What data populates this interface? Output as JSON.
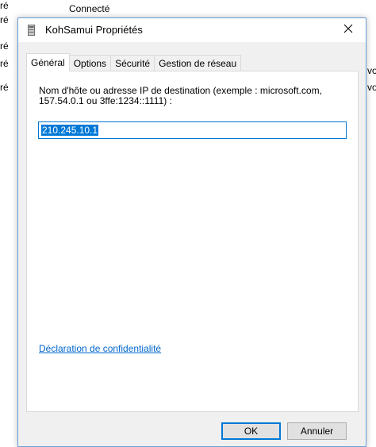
{
  "background": {
    "left_fragments": [
      "ré",
      "ré",
      "ré",
      "ré",
      "ré"
    ],
    "top_text": "Connecté",
    "right_fragments": [
      "vo",
      "vo"
    ]
  },
  "dialog": {
    "title": "KohSamui Propriétés",
    "close_glyph": "✕",
    "tabs": [
      {
        "label": "Général",
        "active": true
      },
      {
        "label": "Options",
        "active": false
      },
      {
        "label": "Sécurité",
        "active": false
      },
      {
        "label": "Gestion de réseau",
        "active": false
      }
    ],
    "general": {
      "description": "Nom d'hôte ou adresse IP de destination (exemple : microsoft.com, 157.54.0.1 ou 3ffe:1234::1111) :",
      "host_value": "210.245.10.1",
      "privacy_link": "Déclaration de confidentialité"
    },
    "buttons": {
      "ok": "OK",
      "cancel": "Annuler"
    }
  },
  "colors": {
    "accent": "#0078d7",
    "link": "#0066cc",
    "dialog_bg": "#f0f0f0",
    "border": "#6a9fd6"
  },
  "icons": {
    "title_icon": "phonebook-icon",
    "close_icon": "close-icon"
  }
}
